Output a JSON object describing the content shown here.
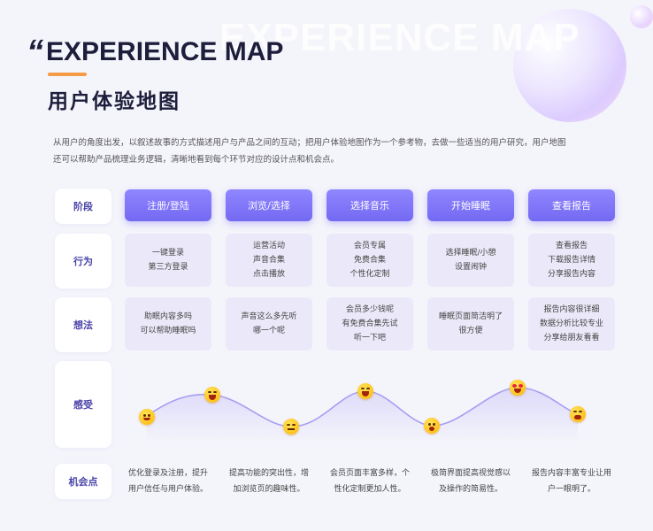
{
  "header": {
    "ghost_text": "EXPERIENCE MAP",
    "quote_mark": "“",
    "title_en": "EXPERIENCE MAP",
    "title_cn": "用户体验地图"
  },
  "description": {
    "line1": "从用户的角度出发，以叙述故事的方式描述用户与产品之间的互动；把用户体验地图作为一个参考物，去做一些适当的用户研究，用户地图",
    "line2": "还可以帮助产品梳理业务逻辑，清晰地看到每个环节对应的设计点和机会点。"
  },
  "rows": {
    "stage": "阶段",
    "behavior": "行为",
    "thought": "想法",
    "feeling": "感受",
    "opportunity": "机会点"
  },
  "stages": [
    "注册/登陆",
    "浏览/选择",
    "选择音乐",
    "开始睡眠",
    "查看报告"
  ],
  "behaviors": [
    [
      "一键登录",
      "第三方登录"
    ],
    [
      "运营活动",
      "声音合集",
      "点击播放"
    ],
    [
      "会员专属",
      "免费合集",
      "个性化定制"
    ],
    [
      "选择睡眠/小憩",
      "设置闹钟"
    ],
    [
      "查看报告",
      "下载报告详情",
      "分享报告内容"
    ]
  ],
  "thoughts": [
    [
      "助眠内容多吗",
      "可以帮助睡眠吗"
    ],
    [
      "声音这么多先听",
      "哪一个呢"
    ],
    [
      "会员多少钱呢",
      "有免费合集先试",
      "听一下吧"
    ],
    [
      "睡眠页面简洁明了",
      "很方便"
    ],
    [
      "报告内容很详细",
      "数据分析比较专业",
      "分享给朋友看看"
    ]
  ],
  "opportunities": [
    [
      "优化登录及注册，提升",
      "用户信任与用户体验。"
    ],
    [
      "提高功能的突出性，增",
      "加浏览页的趣味性。"
    ],
    [
      "会员页面丰富多样，个",
      "性化定制更加人性。"
    ],
    [
      "极简界面提高视觉感以",
      "及操作的简易性。"
    ],
    [
      "报告内容丰富专业让用",
      "户一眼明了。"
    ]
  ],
  "feelings": [
    "smiling-face",
    "laughing-face",
    "neutral-face",
    "laughing-face",
    "worried-face",
    "heart-eyes-face",
    "angry-face"
  ],
  "colors": {
    "accent": "#7469f2",
    "accent_light": "#ebe9f9",
    "orange": "#f59a45",
    "title": "#1e1e3c",
    "curve": "#b2a8f5"
  }
}
